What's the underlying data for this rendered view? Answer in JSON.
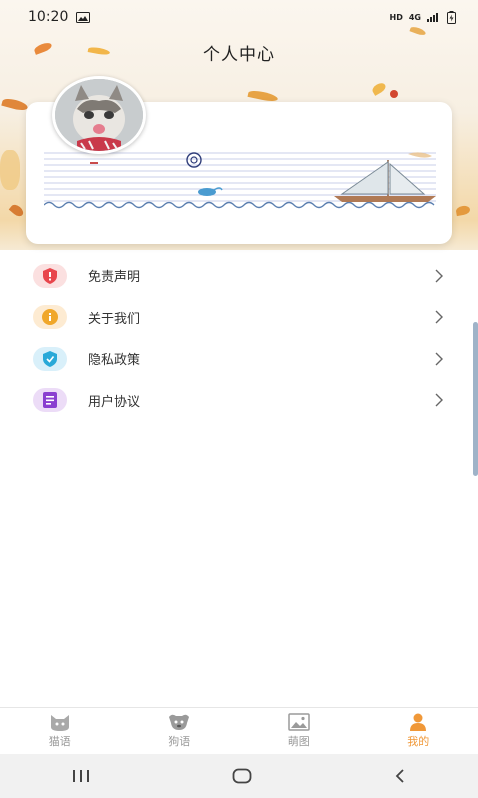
{
  "status_bar": {
    "time": "10:20",
    "hd": "HD",
    "network": "4G"
  },
  "header": {
    "title": "个人中心"
  },
  "menu": {
    "items": [
      {
        "label": "免责声明",
        "icon": "disclaimer-shield-icon",
        "color": "#e8464c"
      },
      {
        "label": "关于我们",
        "icon": "info-icon",
        "color": "#f0a72a"
      },
      {
        "label": "隐私政策",
        "icon": "privacy-shield-icon",
        "color": "#29a9d8"
      },
      {
        "label": "用户协议",
        "icon": "document-icon",
        "color": "#8a3fd0"
      }
    ]
  },
  "tabbar": {
    "tabs": [
      {
        "label": "猫语",
        "icon": "cat-icon",
        "active": false
      },
      {
        "label": "狗语",
        "icon": "dog-icon",
        "active": false
      },
      {
        "label": "萌图",
        "icon": "image-icon",
        "active": false
      },
      {
        "label": "我的",
        "icon": "person-icon",
        "active": true
      }
    ],
    "active_color": "#f09838",
    "inactive_color": "#9a9a9a"
  },
  "nav": {
    "buttons": [
      "recents-button",
      "home-button",
      "back-button"
    ]
  }
}
